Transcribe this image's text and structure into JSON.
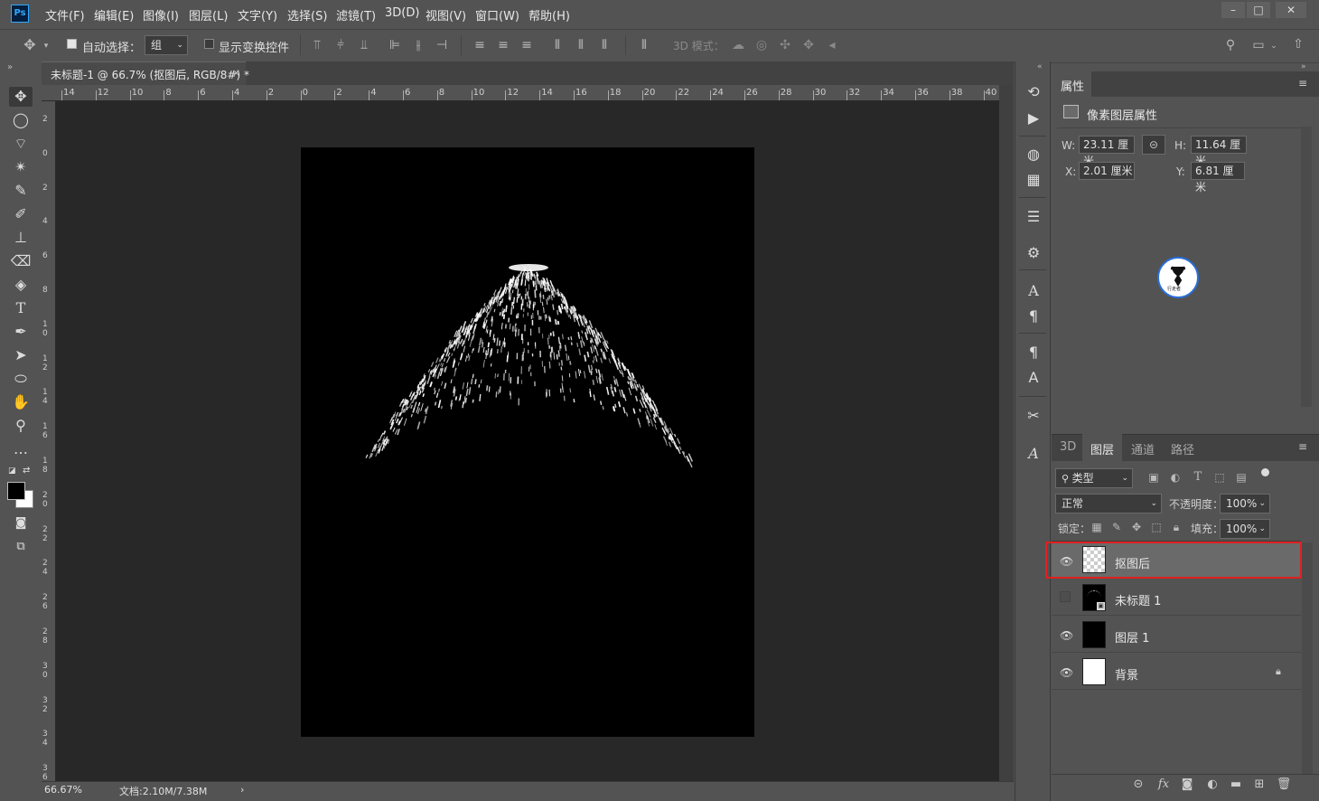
{
  "app": {
    "logo": "Ps"
  },
  "menu": [
    "文件(F)",
    "编辑(E)",
    "图像(I)",
    "图层(L)",
    "文字(Y)",
    "选择(S)",
    "滤镜(T)",
    "3D(D)",
    "视图(V)",
    "窗口(W)",
    "帮助(H)"
  ],
  "options": {
    "auto_select_label": "自动选择：",
    "auto_select_value": "组",
    "show_transform_label": "显示变换控件",
    "mode_3d_label": "3D 模式："
  },
  "document": {
    "tab_title": "未标题-1 @ 66.7% (抠图后, RGB/8#) *",
    "tab_close": "×",
    "canvas_color": "#000000"
  },
  "rulers": {
    "h_labels": [
      "14",
      "12",
      "10",
      "8",
      "6",
      "4",
      "2",
      "0",
      "2",
      "4",
      "6",
      "8",
      "10",
      "12",
      "14",
      "16",
      "18",
      "20",
      "22",
      "24",
      "26",
      "28",
      "30",
      "32",
      "34",
      "36",
      "38",
      "40"
    ],
    "v_labels": [
      "2",
      "0",
      "2",
      "4",
      "6",
      "8",
      "10",
      "12",
      "14",
      "16",
      "18",
      "20",
      "22",
      "24",
      "26",
      "28",
      "30",
      "32",
      "34",
      "36"
    ]
  },
  "status": {
    "zoom": "66.67%",
    "doc_info": "文档:2.10M/7.38M",
    "arrow": "›"
  },
  "properties": {
    "tab": "属性",
    "section_title": "像素图层属性",
    "w_label": "W:",
    "w_value": "23.11 厘米",
    "h_label": "H:",
    "h_value": "11.64 厘米",
    "x_label": "X:",
    "x_value": "2.01 厘米",
    "y_label": "Y:",
    "y_value": "6.81 厘米",
    "watermark_text": "行走者"
  },
  "layers_panel": {
    "tabs": [
      "3D",
      "图层",
      "通道",
      "路径"
    ],
    "filter_kind": "类型",
    "blend_mode": "正常",
    "opacity_label": "不透明度：",
    "opacity_value": "100%",
    "lock_label": "锁定：",
    "fill_label": "填充：",
    "fill_value": "100%",
    "layers": [
      {
        "name": "抠图后",
        "visible": true,
        "active": true
      },
      {
        "name": "未标题 1",
        "visible": false,
        "active": false
      },
      {
        "name": "图层 1",
        "visible": true,
        "active": false
      },
      {
        "name": "背景",
        "visible": true,
        "active": false,
        "locked": true
      }
    ]
  },
  "colors": {
    "accent": "#31a8ff",
    "highlight_box": "#e02020",
    "foreground": "#000000",
    "background": "#ffffff"
  }
}
